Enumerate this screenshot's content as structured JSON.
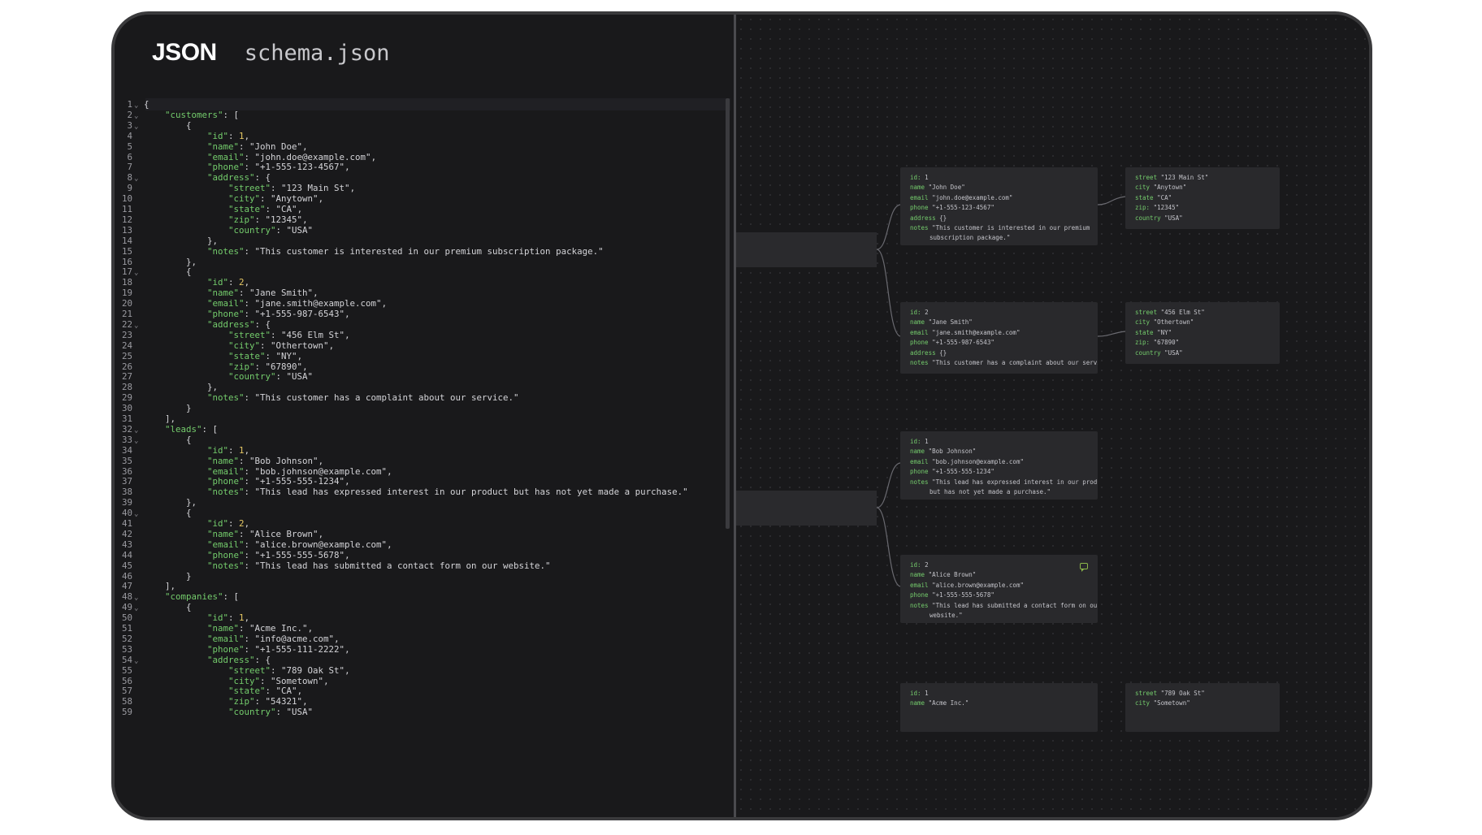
{
  "app": {
    "logo": "JSON",
    "filename": "schema.json"
  },
  "editor": {
    "lines": [
      {
        "n": "1",
        "fold": true,
        "i": 0,
        "p": [
          [
            "p",
            "{"
          ]
        ]
      },
      {
        "n": "2",
        "fold": true,
        "i": 1,
        "p": [
          [
            "k",
            "\"customers\""
          ],
          [
            "p",
            ": ["
          ]
        ]
      },
      {
        "n": "3",
        "fold": true,
        "i": 2,
        "p": [
          [
            "p",
            "{"
          ]
        ]
      },
      {
        "n": "4",
        "i": 3,
        "p": [
          [
            "k",
            "\"id\""
          ],
          [
            "p",
            ": "
          ],
          [
            "n",
            "1"
          ],
          [
            "p",
            ","
          ]
        ]
      },
      {
        "n": "5",
        "i": 3,
        "p": [
          [
            "k",
            "\"name\""
          ],
          [
            "p",
            ": "
          ],
          [
            "s",
            "\"John Doe\""
          ],
          [
            "p",
            ","
          ]
        ]
      },
      {
        "n": "6",
        "i": 3,
        "p": [
          [
            "k",
            "\"email\""
          ],
          [
            "p",
            ": "
          ],
          [
            "s",
            "\"john.doe@example.com\""
          ],
          [
            "p",
            ","
          ]
        ]
      },
      {
        "n": "7",
        "i": 3,
        "p": [
          [
            "k",
            "\"phone\""
          ],
          [
            "p",
            ": "
          ],
          [
            "s",
            "\"+1-555-123-4567\""
          ],
          [
            "p",
            ","
          ]
        ]
      },
      {
        "n": "8",
        "fold": true,
        "i": 3,
        "p": [
          [
            "k",
            "\"address\""
          ],
          [
            "p",
            ": {"
          ]
        ]
      },
      {
        "n": "9",
        "i": 4,
        "p": [
          [
            "k",
            "\"street\""
          ],
          [
            "p",
            ": "
          ],
          [
            "s",
            "\"123 Main St\""
          ],
          [
            "p",
            ","
          ]
        ]
      },
      {
        "n": "10",
        "i": 4,
        "p": [
          [
            "k",
            "\"city\""
          ],
          [
            "p",
            ": "
          ],
          [
            "s",
            "\"Anytown\""
          ],
          [
            "p",
            ","
          ]
        ]
      },
      {
        "n": "11",
        "i": 4,
        "p": [
          [
            "k",
            "\"state\""
          ],
          [
            "p",
            ": "
          ],
          [
            "s",
            "\"CA\""
          ],
          [
            "p",
            ","
          ]
        ]
      },
      {
        "n": "12",
        "i": 4,
        "p": [
          [
            "k",
            "\"zip\""
          ],
          [
            "p",
            ": "
          ],
          [
            "s",
            "\"12345\""
          ],
          [
            "p",
            ","
          ]
        ]
      },
      {
        "n": "13",
        "i": 4,
        "p": [
          [
            "k",
            "\"country\""
          ],
          [
            "p",
            ": "
          ],
          [
            "s",
            "\"USA\""
          ]
        ]
      },
      {
        "n": "14",
        "i": 3,
        "p": [
          [
            "p",
            "},"
          ]
        ]
      },
      {
        "n": "15",
        "i": 3,
        "p": [
          [
            "k",
            "\"notes\""
          ],
          [
            "p",
            ": "
          ],
          [
            "s",
            "\"This customer is interested in our premium subscription package.\""
          ]
        ]
      },
      {
        "n": "16",
        "i": 2,
        "p": [
          [
            "p",
            "},"
          ]
        ]
      },
      {
        "n": "17",
        "fold": true,
        "i": 2,
        "p": [
          [
            "p",
            "{"
          ]
        ]
      },
      {
        "n": "18",
        "i": 3,
        "p": [
          [
            "k",
            "\"id\""
          ],
          [
            "p",
            ": "
          ],
          [
            "n",
            "2"
          ],
          [
            "p",
            ","
          ]
        ]
      },
      {
        "n": "19",
        "i": 3,
        "p": [
          [
            "k",
            "\"name\""
          ],
          [
            "p",
            ": "
          ],
          [
            "s",
            "\"Jane Smith\""
          ],
          [
            "p",
            ","
          ]
        ]
      },
      {
        "n": "20",
        "i": 3,
        "p": [
          [
            "k",
            "\"email\""
          ],
          [
            "p",
            ": "
          ],
          [
            "s",
            "\"jane.smith@example.com\""
          ],
          [
            "p",
            ","
          ]
        ]
      },
      {
        "n": "21",
        "i": 3,
        "p": [
          [
            "k",
            "\"phone\""
          ],
          [
            "p",
            ": "
          ],
          [
            "s",
            "\"+1-555-987-6543\""
          ],
          [
            "p",
            ","
          ]
        ]
      },
      {
        "n": "22",
        "fold": true,
        "i": 3,
        "p": [
          [
            "k",
            "\"address\""
          ],
          [
            "p",
            ": {"
          ]
        ]
      },
      {
        "n": "23",
        "i": 4,
        "p": [
          [
            "k",
            "\"street\""
          ],
          [
            "p",
            ": "
          ],
          [
            "s",
            "\"456 Elm St\""
          ],
          [
            "p",
            ","
          ]
        ]
      },
      {
        "n": "24",
        "i": 4,
        "p": [
          [
            "k",
            "\"city\""
          ],
          [
            "p",
            ": "
          ],
          [
            "s",
            "\"Othertown\""
          ],
          [
            "p",
            ","
          ]
        ]
      },
      {
        "n": "25",
        "i": 4,
        "p": [
          [
            "k",
            "\"state\""
          ],
          [
            "p",
            ": "
          ],
          [
            "s",
            "\"NY\""
          ],
          [
            "p",
            ","
          ]
        ]
      },
      {
        "n": "26",
        "i": 4,
        "p": [
          [
            "k",
            "\"zip\""
          ],
          [
            "p",
            ": "
          ],
          [
            "s",
            "\"67890\""
          ],
          [
            "p",
            ","
          ]
        ]
      },
      {
        "n": "27",
        "i": 4,
        "p": [
          [
            "k",
            "\"country\""
          ],
          [
            "p",
            ": "
          ],
          [
            "s",
            "\"USA\""
          ]
        ]
      },
      {
        "n": "28",
        "i": 3,
        "p": [
          [
            "p",
            "},"
          ]
        ]
      },
      {
        "n": "29",
        "i": 3,
        "p": [
          [
            "k",
            "\"notes\""
          ],
          [
            "p",
            ": "
          ],
          [
            "s",
            "\"This customer has a complaint about our service.\""
          ]
        ]
      },
      {
        "n": "30",
        "i": 2,
        "p": [
          [
            "p",
            "}"
          ]
        ]
      },
      {
        "n": "31",
        "i": 1,
        "p": [
          [
            "p",
            "],"
          ]
        ]
      },
      {
        "n": "32",
        "fold": true,
        "i": 1,
        "p": [
          [
            "k",
            "\"leads\""
          ],
          [
            "p",
            ": ["
          ]
        ]
      },
      {
        "n": "33",
        "fold": true,
        "i": 2,
        "p": [
          [
            "p",
            "{"
          ]
        ]
      },
      {
        "n": "34",
        "i": 3,
        "p": [
          [
            "k",
            "\"id\""
          ],
          [
            "p",
            ": "
          ],
          [
            "n",
            "1"
          ],
          [
            "p",
            ","
          ]
        ]
      },
      {
        "n": "35",
        "i": 3,
        "p": [
          [
            "k",
            "\"name\""
          ],
          [
            "p",
            ": "
          ],
          [
            "s",
            "\"Bob Johnson\""
          ],
          [
            "p",
            ","
          ]
        ]
      },
      {
        "n": "36",
        "i": 3,
        "p": [
          [
            "k",
            "\"email\""
          ],
          [
            "p",
            ": "
          ],
          [
            "s",
            "\"bob.johnson@example.com\""
          ],
          [
            "p",
            ","
          ]
        ]
      },
      {
        "n": "37",
        "i": 3,
        "p": [
          [
            "k",
            "\"phone\""
          ],
          [
            "p",
            ": "
          ],
          [
            "s",
            "\"+1-555-555-1234\""
          ],
          [
            "p",
            ","
          ]
        ]
      },
      {
        "n": "38",
        "i": 3,
        "p": [
          [
            "k",
            "\"notes\""
          ],
          [
            "p",
            ": "
          ],
          [
            "s",
            "\"This lead has expressed interest in our product but has not yet made a purchase.\""
          ]
        ]
      },
      {
        "n": "39",
        "i": 2,
        "p": [
          [
            "p",
            "},"
          ]
        ]
      },
      {
        "n": "40",
        "fold": true,
        "i": 2,
        "p": [
          [
            "p",
            "{"
          ]
        ]
      },
      {
        "n": "41",
        "i": 3,
        "p": [
          [
            "k",
            "\"id\""
          ],
          [
            "p",
            ": "
          ],
          [
            "n",
            "2"
          ],
          [
            "p",
            ","
          ]
        ]
      },
      {
        "n": "42",
        "i": 3,
        "p": [
          [
            "k",
            "\"name\""
          ],
          [
            "p",
            ": "
          ],
          [
            "s",
            "\"Alice Brown\""
          ],
          [
            "p",
            ","
          ]
        ]
      },
      {
        "n": "43",
        "i": 3,
        "p": [
          [
            "k",
            "\"email\""
          ],
          [
            "p",
            ": "
          ],
          [
            "s",
            "\"alice.brown@example.com\""
          ],
          [
            "p",
            ","
          ]
        ]
      },
      {
        "n": "44",
        "i": 3,
        "p": [
          [
            "k",
            "\"phone\""
          ],
          [
            "p",
            ": "
          ],
          [
            "s",
            "\"+1-555-555-5678\""
          ],
          [
            "p",
            ","
          ]
        ]
      },
      {
        "n": "45",
        "i": 3,
        "p": [
          [
            "k",
            "\"notes\""
          ],
          [
            "p",
            ": "
          ],
          [
            "s",
            "\"This lead has submitted a contact form on our website.\""
          ]
        ]
      },
      {
        "n": "46",
        "i": 2,
        "p": [
          [
            "p",
            "}"
          ]
        ]
      },
      {
        "n": "47",
        "i": 1,
        "p": [
          [
            "p",
            "],"
          ]
        ]
      },
      {
        "n": "48",
        "fold": true,
        "i": 1,
        "p": [
          [
            "k",
            "\"companies\""
          ],
          [
            "p",
            ": ["
          ]
        ]
      },
      {
        "n": "49",
        "fold": true,
        "i": 2,
        "p": [
          [
            "p",
            "{"
          ]
        ]
      },
      {
        "n": "50",
        "i": 3,
        "p": [
          [
            "k",
            "\"id\""
          ],
          [
            "p",
            ": "
          ],
          [
            "n",
            "1"
          ],
          [
            "p",
            ","
          ]
        ]
      },
      {
        "n": "51",
        "i": 3,
        "p": [
          [
            "k",
            "\"name\""
          ],
          [
            "p",
            ": "
          ],
          [
            "s",
            "\"Acme Inc.\""
          ],
          [
            "p",
            ","
          ]
        ]
      },
      {
        "n": "52",
        "i": 3,
        "p": [
          [
            "k",
            "\"email\""
          ],
          [
            "p",
            ": "
          ],
          [
            "s",
            "\"info@acme.com\""
          ],
          [
            "p",
            ","
          ]
        ]
      },
      {
        "n": "53",
        "i": 3,
        "p": [
          [
            "k",
            "\"phone\""
          ],
          [
            "p",
            ": "
          ],
          [
            "s",
            "\"+1-555-111-2222\""
          ],
          [
            "p",
            ","
          ]
        ]
      },
      {
        "n": "54",
        "fold": true,
        "i": 3,
        "p": [
          [
            "k",
            "\"address\""
          ],
          [
            "p",
            ": {"
          ]
        ]
      },
      {
        "n": "55",
        "i": 4,
        "p": [
          [
            "k",
            "\"street\""
          ],
          [
            "p",
            ": "
          ],
          [
            "s",
            "\"789 Oak St\""
          ],
          [
            "p",
            ","
          ]
        ]
      },
      {
        "n": "56",
        "i": 4,
        "p": [
          [
            "k",
            "\"city\""
          ],
          [
            "p",
            ": "
          ],
          [
            "s",
            "\"Sometown\""
          ],
          [
            "p",
            ","
          ]
        ]
      },
      {
        "n": "57",
        "i": 4,
        "p": [
          [
            "k",
            "\"state\""
          ],
          [
            "p",
            ": "
          ],
          [
            "s",
            "\"CA\""
          ],
          [
            "p",
            ","
          ]
        ]
      },
      {
        "n": "58",
        "i": 4,
        "p": [
          [
            "k",
            "\"zip\""
          ],
          [
            "p",
            ": "
          ],
          [
            "s",
            "\"54321\""
          ],
          [
            "p",
            ","
          ]
        ]
      },
      {
        "n": "59",
        "i": 4,
        "p": [
          [
            "k",
            "\"country\""
          ],
          [
            "p",
            ": "
          ],
          [
            "s",
            "\"USA\""
          ]
        ]
      }
    ]
  },
  "graph": {
    "nodes": [
      {
        "id": "c1",
        "rows": [
          [
            "id:",
            "1"
          ],
          [
            "name",
            "\"John Doe\""
          ],
          [
            "email",
            "\"john.doe@example.com\""
          ],
          [
            "phone",
            "\"+1-555-123-4567\""
          ],
          [
            "address",
            "{}"
          ],
          [
            "notes",
            "\"This customer is interested in our premium"
          ],
          [
            "",
            "subscription package.\""
          ]
        ]
      },
      {
        "id": "a1",
        "rows": [
          [
            "street",
            "\"123 Main St\""
          ],
          [
            "city",
            "\"Anytown\""
          ],
          [
            "state",
            "\"CA\""
          ],
          [
            "zip:",
            "\"12345\""
          ],
          [
            "country",
            "\"USA\""
          ]
        ]
      },
      {
        "id": "c2",
        "rows": [
          [
            "id:",
            "2"
          ],
          [
            "name",
            "\"Jane Smith\""
          ],
          [
            "email",
            "\"jane.smith@example.com\""
          ],
          [
            "phone",
            "\"+1-555-987-6543\""
          ],
          [
            "address",
            "{}"
          ],
          [
            "notes",
            "\"This customer has a complaint about our service.\""
          ]
        ]
      },
      {
        "id": "a2",
        "rows": [
          [
            "street",
            "\"456 Elm St\""
          ],
          [
            "city",
            "\"Othertown\""
          ],
          [
            "state",
            "\"NY\""
          ],
          [
            "zip:",
            "\"67890\""
          ],
          [
            "country",
            "\"USA\""
          ]
        ]
      },
      {
        "id": "l1",
        "rows": [
          [
            "id:",
            "1"
          ],
          [
            "name",
            "\"Bob Johnson\""
          ],
          [
            "email",
            "\"bob.johnson@example.com\""
          ],
          [
            "phone",
            "\"+1-555-555-1234\""
          ],
          [
            "notes",
            "\"This lead has expressed interest in our product"
          ],
          [
            "",
            "but has not yet made a purchase.\""
          ]
        ]
      },
      {
        "id": "l2",
        "comment": true,
        "rows": [
          [
            "id:",
            "2"
          ],
          [
            "name",
            "\"Alice Brown\""
          ],
          [
            "email",
            "\"alice.brown@example.com\""
          ],
          [
            "phone",
            "\"+1-555-555-5678\""
          ],
          [
            "notes",
            "\"This lead has submitted a contact form on our"
          ],
          [
            "",
            "website.\""
          ]
        ]
      },
      {
        "id": "co1",
        "rows": [
          [
            "id:",
            "1"
          ],
          [
            "name",
            "\"Acme Inc.\""
          ]
        ]
      },
      {
        "id": "a3",
        "rows": [
          [
            "street",
            "\"789 Oak St\""
          ],
          [
            "city",
            "\"Sometown\""
          ]
        ]
      }
    ]
  },
  "colors": {
    "key": "#74cc6c",
    "number": "#e6c864",
    "string": "#d4d4d8",
    "background": "#19191b",
    "node": "#29292c"
  }
}
